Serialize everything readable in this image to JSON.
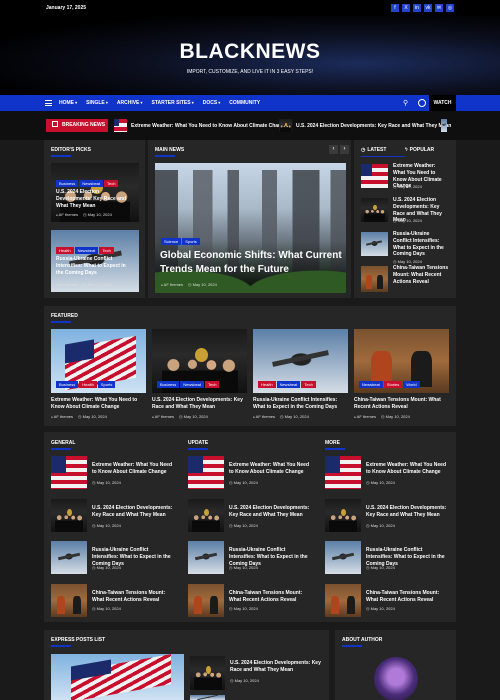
{
  "topbar": {
    "date": "January 17, 2025",
    "socials": [
      "f",
      "X",
      "in",
      "vk",
      "✉",
      "◎"
    ]
  },
  "site": {
    "title": "BLACKNEWS",
    "tagline": "IMPORT, CUSTOMIZE, AND LIVE IT IN 3 EASY STEPS!"
  },
  "nav": {
    "items": [
      "HOME",
      "SINGLE",
      "ARCHIVE",
      "STARTER SITES",
      "DOCS",
      "COMMUNITY"
    ],
    "watch": "WATCH"
  },
  "breaking": {
    "label": "BREAKING NEWS",
    "items": [
      "Extreme Weather: What You Need to Know About Climate Change",
      "U.S. 2024 Election Developments: Key Race and What They Mean"
    ]
  },
  "meta": {
    "author": "AF themes",
    "date": "May 10, 2024"
  },
  "articles": {
    "climate": "Extreme Weather: What You Need to Know About Climate Change",
    "election": "U.S. 2024 Election Developments: Key Race and What They Mean",
    "russia": "Russia-Ukraine Conflict Intensifies: What to Expect in the Coming Days",
    "china": "China-Taiwan Tensions Mount: What Recent Actions Reveal"
  },
  "tags": {
    "business": "Business",
    "newsbeat": "Newsbeat",
    "tech": "Tech",
    "health": "Health",
    "science": "Science",
    "sports": "Sports",
    "stories": "Stories",
    "world": "World"
  },
  "editors": {
    "title": "EDITOR'S PICKS"
  },
  "main": {
    "title": "MAIN NEWS",
    "headline": "Global Economic Shifts: What Current Trends Mean for the Future"
  },
  "side": {
    "tab_latest": "LATEST",
    "tab_popular": "POPULAR"
  },
  "featured": {
    "title": "FEATURED"
  },
  "columns": [
    "GENERAL",
    "UPDATE",
    "MORE"
  ],
  "express": {
    "title": "EXPRESS POSTS LIST"
  },
  "author": {
    "title": "ABOUT AUTHOR"
  },
  "colors": {
    "accent": "#1033c9",
    "breaking": "#c8102e",
    "panel": "#262626",
    "background": "#1a1a1a"
  }
}
